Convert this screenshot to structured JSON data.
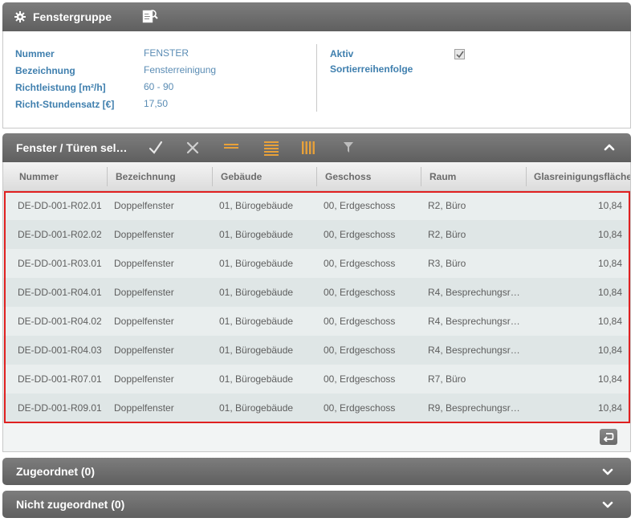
{
  "header": {
    "title": "Fenstergruppe"
  },
  "info": {
    "fields": [
      {
        "label": "Nummer",
        "value": "FENSTER"
      },
      {
        "label": "Bezeichnung",
        "value": "Fensterreinigung"
      },
      {
        "label": "Richtleistung [m²/h]",
        "value": "60 - 90"
      },
      {
        "label": "Richt-Stundensatz [€]",
        "value": "17,50"
      }
    ],
    "right_fields": [
      {
        "label": "Aktiv"
      },
      {
        "label": "Sortierreihenfolge"
      }
    ],
    "aktiv_checked": true
  },
  "grid": {
    "title": "Fenster / Türen sel…",
    "columns": [
      "Nummer",
      "Bezeichnung",
      "Gebäude",
      "Geschoss",
      "Raum",
      "Glasreinigungsfläche"
    ],
    "rows": [
      [
        "DE-DD-001-R02.01",
        "Doppelfenster",
        "01, Bürogebäude",
        "00, Erdgeschoss",
        "R2, Büro",
        "10,84"
      ],
      [
        "DE-DD-001-R02.02",
        "Doppelfenster",
        "01, Bürogebäude",
        "00, Erdgeschoss",
        "R2, Büro",
        "10,84"
      ],
      [
        "DE-DD-001-R03.01",
        "Doppelfenster",
        "01, Bürogebäude",
        "00, Erdgeschoss",
        "R3, Büro",
        "10,84"
      ],
      [
        "DE-DD-001-R04.01",
        "Doppelfenster",
        "01, Bürogebäude",
        "00, Erdgeschoss",
        "R4, Besprechungsr…",
        "10,84"
      ],
      [
        "DE-DD-001-R04.02",
        "Doppelfenster",
        "01, Bürogebäude",
        "00, Erdgeschoss",
        "R4, Besprechungsr…",
        "10,84"
      ],
      [
        "DE-DD-001-R04.03",
        "Doppelfenster",
        "01, Bürogebäude",
        "00, Erdgeschoss",
        "R4, Besprechungsr…",
        "10,84"
      ],
      [
        "DE-DD-001-R07.01",
        "Doppelfenster",
        "01, Bürogebäude",
        "00, Erdgeschoss",
        "R7, Büro",
        "10,84"
      ],
      [
        "DE-DD-001-R09.01",
        "Doppelfenster",
        "01, Bürogebäude",
        "00, Erdgeschoss",
        "R9, Besprechungsr…",
        "10,84"
      ]
    ]
  },
  "sections": {
    "zugeordnet": "Zugeordnet (0)",
    "nicht_zugeordnet": "Nicht zugeordnet (0)"
  },
  "colors": {
    "label": "#3f7fae",
    "value": "#5a8cb4",
    "header": "#6e6e6e",
    "highlight": "#e02020",
    "accent_orange": "#e8a13a"
  }
}
